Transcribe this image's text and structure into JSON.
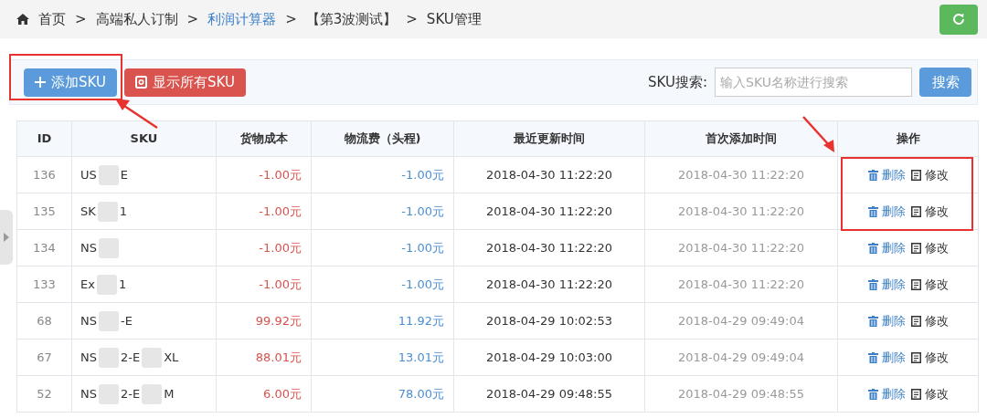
{
  "breadcrumb": [
    {
      "label": "首页",
      "link": false
    },
    {
      "label": "高端私人订制",
      "link": false
    },
    {
      "label": "利润计算器",
      "link": true
    },
    {
      "label": "【第3波测试】",
      "link": false
    },
    {
      "label": "SKU管理",
      "link": false
    }
  ],
  "separator": ">",
  "toolbar": {
    "add_button": "添加SKU",
    "show_all_button": "显示所有SKU",
    "search_label": "SKU搜索:",
    "search_placeholder": "输入SKU名称进行搜索",
    "search_button": "搜索"
  },
  "table": {
    "columns": [
      "ID",
      "SKU",
      "货物成本",
      "物流费（头程)",
      "最近更新时间",
      "首次添加时间",
      "操作"
    ],
    "rows": [
      {
        "id": "136",
        "sku": [
          "US",
          "E"
        ],
        "cost": "-1.00元",
        "shipping": "-1.00元",
        "updated": "2018-04-30 11:22:20",
        "added": "2018-04-30 11:22:20",
        "delete": "删除",
        "edit": "修改"
      },
      {
        "id": "135",
        "sku": [
          "SK",
          "1"
        ],
        "cost": "-1.00元",
        "shipping": "-1.00元",
        "updated": "2018-04-30 11:22:20",
        "added": "2018-04-30 11:22:20",
        "delete": "删除",
        "edit": "修改"
      },
      {
        "id": "134",
        "sku": [
          "NS"
        ],
        "cost": "-1.00元",
        "shipping": "-1.00元",
        "updated": "2018-04-30 11:22:20",
        "added": "2018-04-30 11:22:20",
        "delete": "删除",
        "edit": "修改"
      },
      {
        "id": "133",
        "sku": [
          "Ex",
          "1"
        ],
        "cost": "-1.00元",
        "shipping": "-1.00元",
        "updated": "2018-04-30 11:22:20",
        "added": "2018-04-30 11:22:20",
        "delete": "删除",
        "edit": "修改"
      },
      {
        "id": "68",
        "sku": [
          "NS",
          "-E"
        ],
        "cost": "99.92元",
        "shipping": "11.92元",
        "updated": "2018-04-29 10:02:53",
        "added": "2018-04-29 09:49:04",
        "delete": "删除",
        "edit": "修改"
      },
      {
        "id": "67",
        "sku": [
          "NS",
          "2-E",
          "XL"
        ],
        "cost": "88.01元",
        "shipping": "13.01元",
        "updated": "2018-04-29 10:03:00",
        "added": "2018-04-29 09:49:04",
        "delete": "删除",
        "edit": "修改"
      },
      {
        "id": "52",
        "sku": [
          "NS",
          "2-E",
          "M"
        ],
        "cost": "6.00元",
        "shipping": "78.00元",
        "updated": "2018-04-29 09:48:55",
        "added": "2018-04-29 09:48:55",
        "delete": "删除",
        "edit": "修改"
      }
    ]
  }
}
